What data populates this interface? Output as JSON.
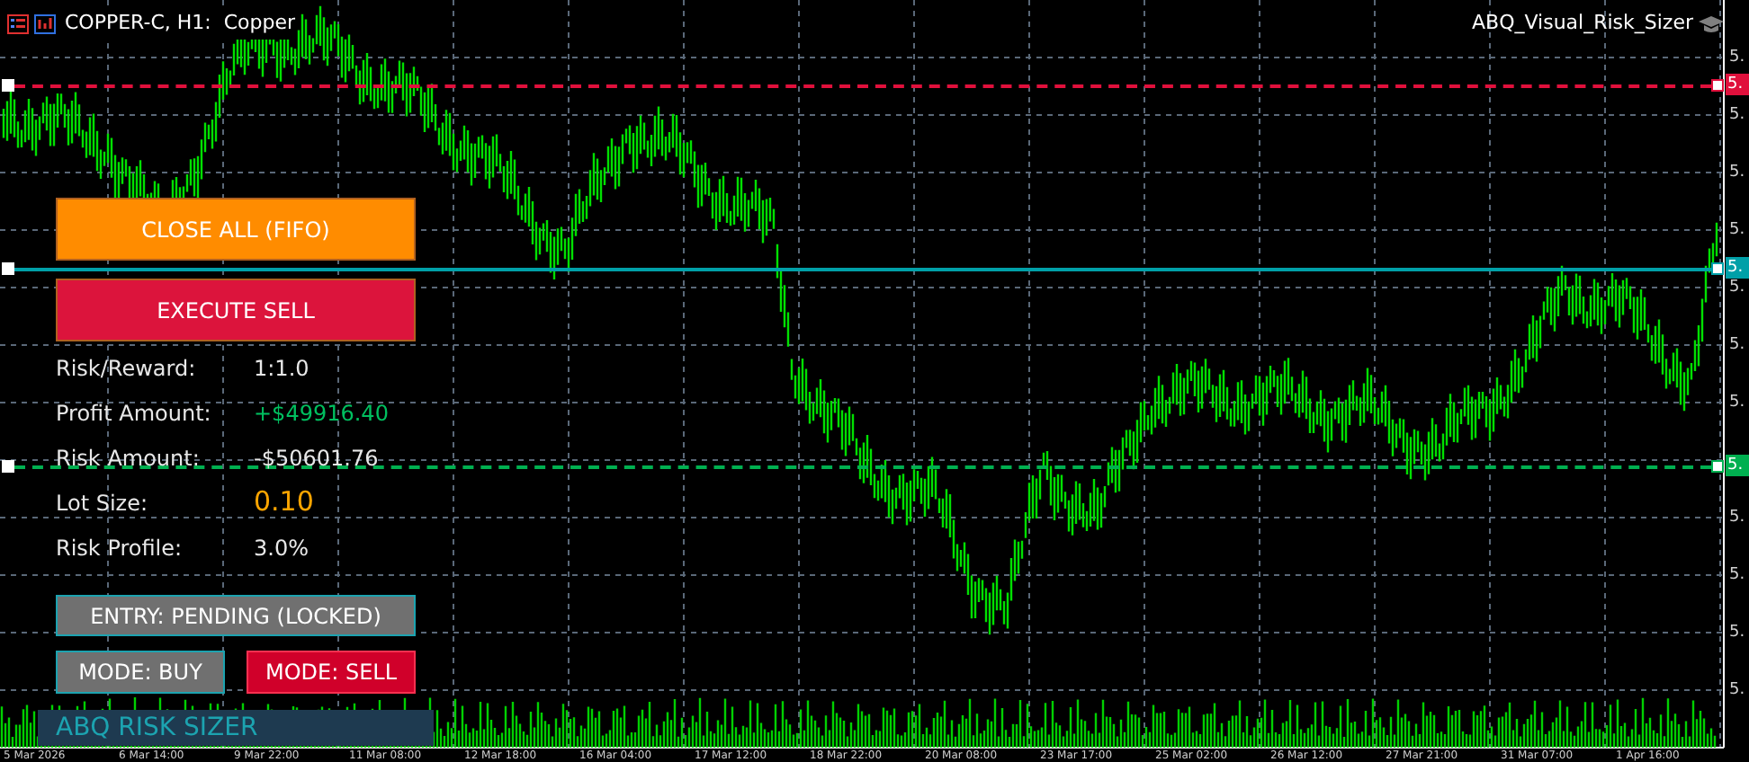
{
  "window": {
    "title": "COPPER-C, H1:  Copper",
    "indicator": "ABQ_Visual_Risk_Sizer"
  },
  "panel": {
    "buttons": [
      {
        "label": "CLOSE ALL (FIFO)",
        "kind": "close_all"
      },
      {
        "label": "EXECUTE SELL",
        "kind": "execute"
      }
    ],
    "stats": [
      {
        "label": "Risk/Reward:",
        "value": "1:1.0",
        "kind": "plain"
      },
      {
        "label": "Profit Amount:",
        "value": "+$49916.40",
        "kind": "profit"
      },
      {
        "label": "Risk Amount:",
        "value": "-$50601.76",
        "kind": "plain"
      },
      {
        "label": "Lot Size:",
        "value": "0.10",
        "kind": "lot"
      },
      {
        "label": "Risk Profile:",
        "value": "3.0%",
        "kind": "plain"
      }
    ],
    "entry_button": "ENTRY: PENDING (LOCKED)",
    "modes": [
      {
        "label": "MODE: BUY",
        "selected": false
      },
      {
        "label": "MODE: SELL",
        "selected": true
      }
    ],
    "brand": "ABQ RISK SIZER"
  },
  "price_axis": {
    "labels": [
      "5.",
      "5.",
      "5.",
      "5.",
      "5.",
      "5.",
      "5.",
      "5.",
      "5.",
      "5.",
      "5."
    ],
    "tags": [
      {
        "label": "5.",
        "color": "#e0103c",
        "kind": "dashed"
      },
      {
        "label": "5.",
        "color": "#00a0a8",
        "kind": "solid"
      },
      {
        "label": "5.",
        "color": "#00b050",
        "kind": "dashed"
      }
    ]
  },
  "time_axis": {
    "labels": [
      "5 Mar 2026",
      "6 Mar 14:00",
      "9 Mar 22:00",
      "11 Mar 08:00",
      "12 Mar 18:00",
      "16 Mar 04:00",
      "17 Mar 12:00",
      "18 Mar 22:00",
      "20 Mar 08:00",
      "23 Mar 17:00",
      "25 Mar 02:00",
      "26 Mar 12:00",
      "27 Mar 21:00",
      "31 Mar 07:00",
      "1 Apr 16:00"
    ]
  }
}
